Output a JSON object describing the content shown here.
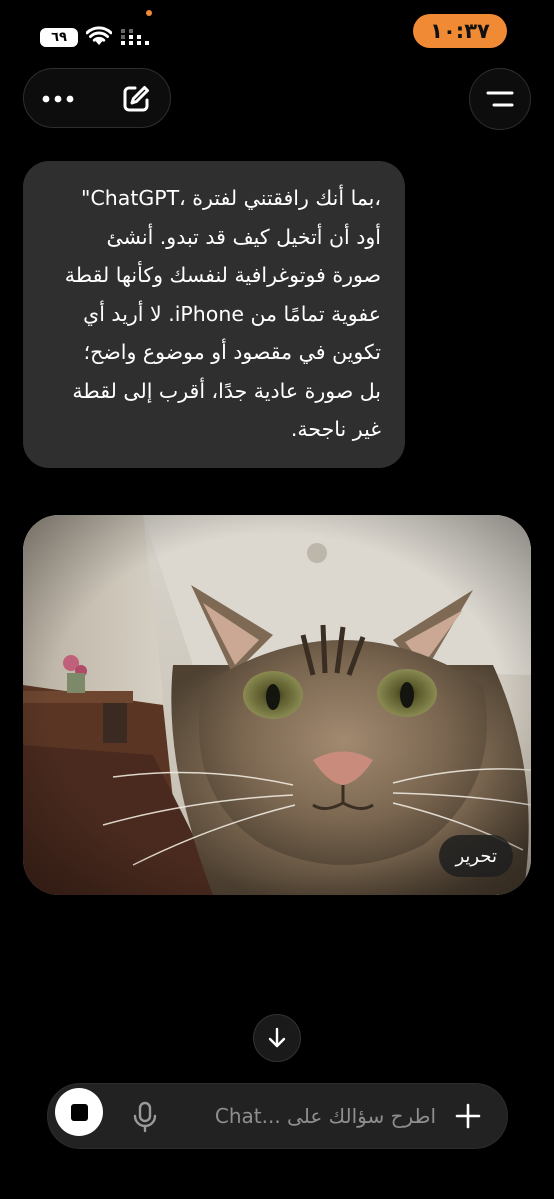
{
  "status_bar": {
    "time": "١٠:٣٧",
    "battery": "٦٩",
    "accent_color": "#f08a35"
  },
  "header": {
    "more_icon": "ellipsis-icon",
    "new_chat_icon": "compose-icon",
    "menu_icon": "hamburger-icon"
  },
  "message": {
    "lines": [
      "\"ChatGPT، بما أنك رافقتني لفترة،",
      "أود أن أتخيل كيف قد تبدو. أنشئ",
      "صورة فوتوغرافية لنفسك وكأنها لقطة",
      "عفوية تمامًا من iPhone. لا أريد أي",
      "تكوين في مقصود أو موضوع واضح؛",
      "بل صورة عادية جدًا، أقرب إلى لقطة",
      "غير ناجحة."
    ]
  },
  "image": {
    "edit_label": "تحرير"
  },
  "composer": {
    "placeholder": "اطرح سؤالك على ...Chat",
    "stop_icon": "stop-icon",
    "mic_icon": "microphone-icon",
    "plus_icon": "plus-icon",
    "scroll_icon": "arrow-down-icon"
  }
}
